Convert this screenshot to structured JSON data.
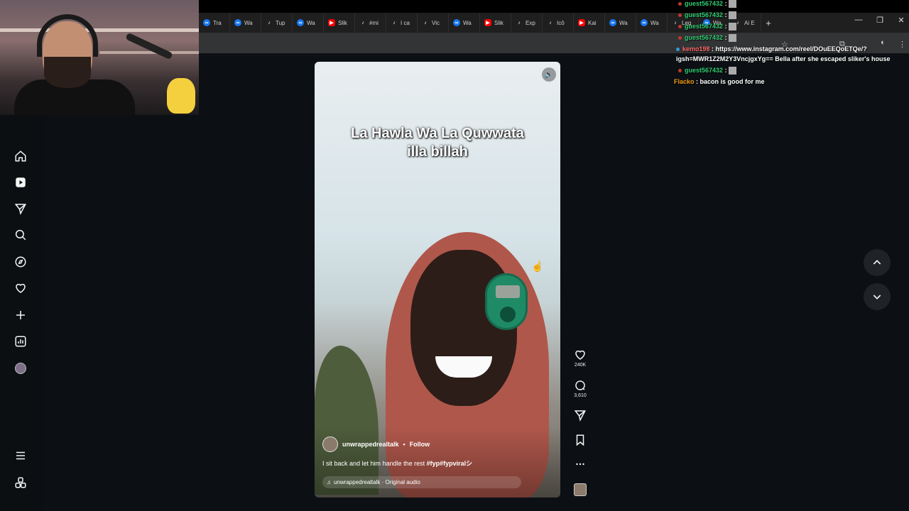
{
  "browser": {
    "tabs": [
      {
        "label": "Tra",
        "icon": "meta-icon"
      },
      {
        "label": "Wa",
        "icon": "meta-icon"
      },
      {
        "label": "Tup",
        "icon": "tiktok-icon"
      },
      {
        "label": "Wa",
        "icon": "meta-icon"
      },
      {
        "label": "Slik",
        "icon": "youtube-icon"
      },
      {
        "label": "#mi",
        "icon": "tiktok-icon"
      },
      {
        "label": "I ca",
        "icon": "tiktok-icon"
      },
      {
        "label": "Vic",
        "icon": "tiktok-icon"
      },
      {
        "label": "Wa",
        "icon": "meta-icon"
      },
      {
        "label": "Slik",
        "icon": "youtube-icon"
      },
      {
        "label": "Exp",
        "icon": "tiktok-icon"
      },
      {
        "label": "Icô",
        "icon": "tiktok-icon"
      },
      {
        "label": "Kai",
        "icon": "youtube-icon"
      },
      {
        "label": "Wa",
        "icon": "meta-icon"
      },
      {
        "label": "Wa",
        "icon": "meta-icon"
      },
      {
        "label": "Leg",
        "icon": "tiktok-icon"
      },
      {
        "label": "Wa",
        "icon": "meta-icon"
      },
      {
        "label": "Ai E",
        "icon": "tiktok-icon"
      }
    ],
    "new_tab": "+",
    "minimize": "—",
    "restore": "❐",
    "close": "✕"
  },
  "reel": {
    "caption_line1": "La Hawla Wa La Quwwata",
    "caption_line2": "illa billah",
    "author": "unwrappedrealtalk",
    "separator": "•",
    "follow": "Follow",
    "description": "I sit back and let him handle the rest ",
    "hashtags": "#fyp#fypviralシ",
    "audio": "unwrappedrealtalk · Original audio",
    "likes": "240K",
    "comments": "3,610"
  },
  "chat": [
    {
      "user": "guest567432",
      "message": ":",
      "color": "#2ecc71"
    },
    {
      "user": "guest567432",
      "message": ":",
      "color": "#2ecc71"
    },
    {
      "user": "guest567432",
      "message": ":",
      "color": "#2ecc71"
    },
    {
      "user": "guest567432",
      "message": ":",
      "color": "#2ecc71"
    },
    {
      "user": "kemo198",
      "message": ": https://www.instagram.com/reel/DOuEEQoETQe/?",
      "color": "#ff6b6b"
    },
    {
      "user": "",
      "message": "igsh=MWR1Z2M2Y3VncjgxYg== Bella after she escaped sliker's house",
      "color": "#ffffff"
    },
    {
      "user": "guest567432",
      "message": ":",
      "color": "#2ecc71"
    },
    {
      "user": "Flacko",
      "message": ": bacon is good for me",
      "color": "#f39c12"
    }
  ],
  "colors": {
    "accent": "#0095f6",
    "background": "#0c1014"
  }
}
